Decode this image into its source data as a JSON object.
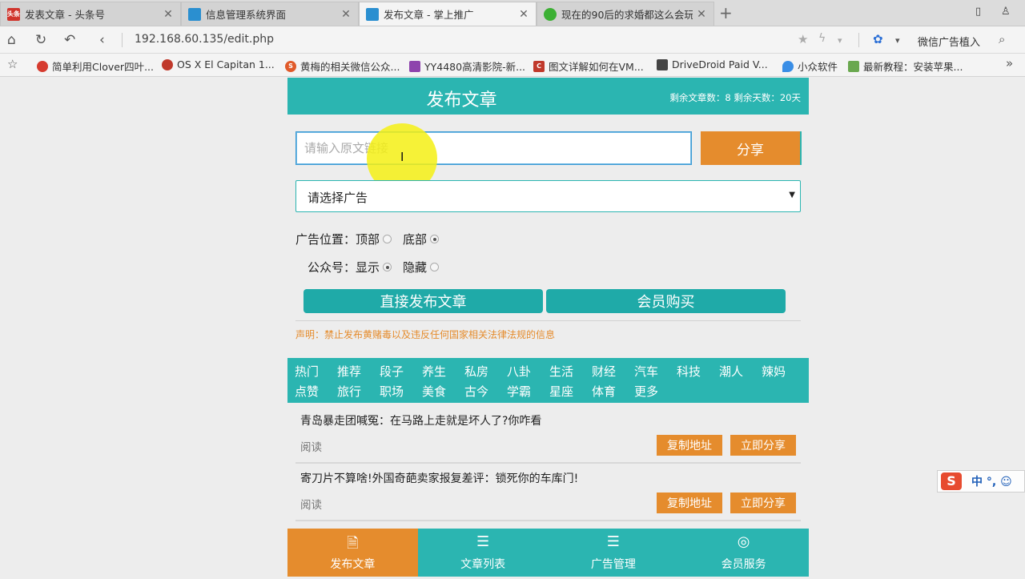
{
  "browser": {
    "tabs": [
      {
        "title": "发表文章 - 头条号",
        "icon_name": "toutiao-icon",
        "icon_color": "#d0342c",
        "icon_text": "头条",
        "active": false
      },
      {
        "title": "信息管理系统界面",
        "icon_name": "page-icon",
        "icon_color": "#2a8fd0",
        "icon_text": "",
        "active": false
      },
      {
        "title": "发布文章 - 掌上推广",
        "icon_name": "page-icon",
        "icon_color": "#2a8fd0",
        "icon_text": "",
        "active": true
      },
      {
        "title": "现在的90后的求婚都这么会玩",
        "icon_name": "wechat-icon",
        "icon_color": "#3cb034",
        "icon_text": "",
        "active": false
      }
    ],
    "url": "192.168.60.135/edit.php",
    "search_engine_label": "微信广告植入",
    "bookmarks": [
      {
        "label": "简单利用Clover四叶...",
        "icon_name": "clover-icon",
        "icon_color": "#d63b2f"
      },
      {
        "label": "OS X El Capitan 1...",
        "icon_name": "site-icon",
        "icon_color": "#c0392b"
      },
      {
        "label": "黄梅的相关微信公众...",
        "icon_name": "sogou-icon",
        "icon_color": "#e05a2a"
      },
      {
        "label": "YY4480高清影院-新...",
        "icon_name": "yy-icon",
        "icon_color": "#8e44ad"
      },
      {
        "label": "图文详解如何在VM...",
        "icon_name": "c-icon",
        "icon_color": "#c0392b"
      },
      {
        "label": "DriveDroid Paid V...",
        "icon_name": "drivedroid-icon",
        "icon_color": "#444444"
      },
      {
        "label": "小众软件",
        "icon_name": "droplet-icon",
        "icon_color": "#3a8ee6"
      },
      {
        "label": "最新教程：安装苹果...",
        "icon_name": "site-icon",
        "icon_color": "#6aa84f"
      }
    ]
  },
  "page": {
    "header_title": "发布文章",
    "header_stats": "剩余文章数：8  剩余天数：20天",
    "url_placeholder": "请输入原文链接",
    "share_label": "分享",
    "ad_select_label": "请选择广告",
    "ad_position_label": "广告位置：",
    "ad_position_options": [
      {
        "label": "顶部",
        "checked": false
      },
      {
        "label": "底部",
        "checked": true
      }
    ],
    "account_label": "公众号：",
    "account_options": [
      {
        "label": "显示",
        "checked": true
      },
      {
        "label": "隐藏",
        "checked": false
      }
    ],
    "publish_button": "直接发布文章",
    "member_buy_button": "会员购买",
    "disclaimer": "声明：禁止发布黄赌毒以及违反任何国家相关法律法规的信息",
    "categories_row1": [
      "热门",
      "推荐",
      "段子",
      "养生",
      "私房",
      "八卦",
      "生活",
      "财经",
      "汽车",
      "科技",
      "潮人",
      "辣妈"
    ],
    "categories_row2": [
      "点赞",
      "旅行",
      "职场",
      "美食",
      "古今",
      "学霸",
      "星座",
      "体育",
      "更多"
    ],
    "articles": [
      {
        "title": "青岛暴走团喊冤：在马路上走就是坏人了?你咋看",
        "read_label": "阅读",
        "copy_label": "复制地址",
        "share_label": "立即分享"
      },
      {
        "title": "寄刀片不算啥!外国奇葩卖家报复差评：锁死你的车库门!",
        "read_label": "阅读",
        "copy_label": "复制地址",
        "share_label": "立即分享"
      }
    ],
    "bottom_nav": [
      {
        "label": "发布文章",
        "icon_name": "document-icon",
        "active": true
      },
      {
        "label": "文章列表",
        "icon_name": "list-icon",
        "active": false
      },
      {
        "label": "广告管理",
        "icon_name": "settings-list-icon",
        "active": false
      },
      {
        "label": "会员服务",
        "icon_name": "user-icon",
        "active": false
      }
    ],
    "accent_color": "#2bb5b1",
    "orange_color": "#e58c2d"
  },
  "ime": {
    "logo": "S",
    "text": "中 °, ☺"
  }
}
